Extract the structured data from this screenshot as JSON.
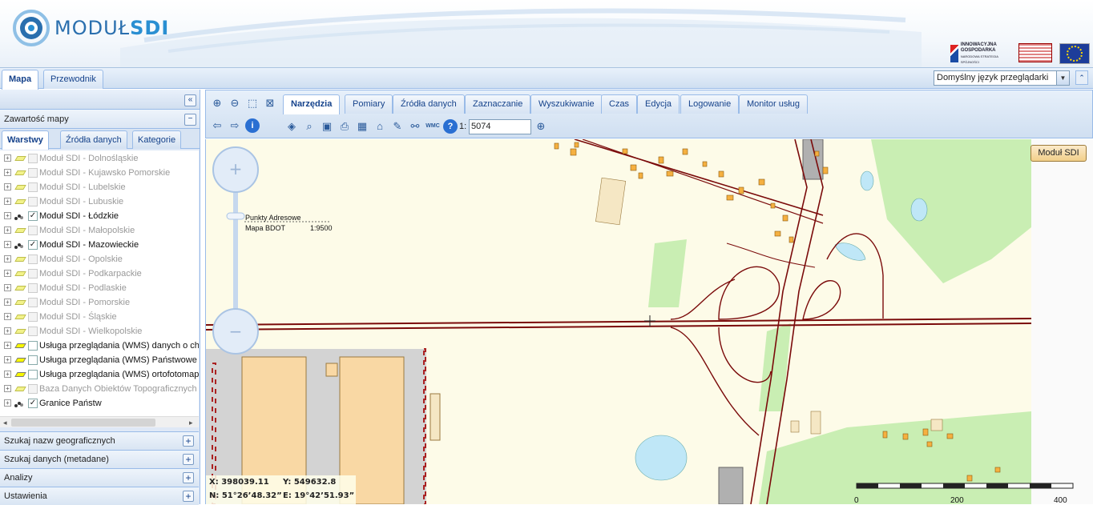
{
  "header": {
    "logo_text_a": "MODUŁ",
    "logo_text_b": "SDI",
    "eu_logo_1_title": "INNOWACYJNA GOSPODARKA",
    "eu_logo_1_sub": "NARODOWA STRATEGIA SPÓJNOŚCI"
  },
  "topbar": {
    "tabs": [
      "Mapa",
      "Przewodnik"
    ],
    "language_select": "Domyślny język przeglądarki"
  },
  "leftpanel": {
    "contents_title": "Zawartość mapy",
    "tabs": [
      "Warstwy",
      "Źródła danych",
      "Kategorie"
    ],
    "layers": [
      {
        "label": "Moduł SDI - Dolnośląskie",
        "icon": "polygon-icon",
        "checked": false,
        "enabled": false
      },
      {
        "label": "Moduł SDI - Kujawsko Pomorskie",
        "icon": "polygon-icon",
        "checked": false,
        "enabled": false
      },
      {
        "label": "Moduł SDI - Lubelskie",
        "icon": "polygon-icon",
        "checked": false,
        "enabled": false
      },
      {
        "label": "Moduł SDI - Lubuskie",
        "icon": "polygon-icon",
        "checked": false,
        "enabled": false
      },
      {
        "label": "Moduł SDI - Łódzkie",
        "icon": "points-icon",
        "checked": true,
        "enabled": true
      },
      {
        "label": "Moduł SDI - Małopolskie",
        "icon": "polygon-icon",
        "checked": false,
        "enabled": false
      },
      {
        "label": "Moduł SDI - Mazowieckie",
        "icon": "points-icon",
        "checked": true,
        "enabled": true
      },
      {
        "label": "Moduł SDI - Opolskie",
        "icon": "polygon-icon",
        "checked": false,
        "enabled": false
      },
      {
        "label": "Moduł SDI - Podkarpackie",
        "icon": "polygon-icon",
        "checked": false,
        "enabled": false
      },
      {
        "label": "Moduł SDI - Podlaskie",
        "icon": "polygon-icon",
        "checked": false,
        "enabled": false
      },
      {
        "label": "Moduł SDI - Pomorskie",
        "icon": "polygon-icon",
        "checked": false,
        "enabled": false
      },
      {
        "label": "Moduł SDI - Śląskie",
        "icon": "polygon-icon",
        "checked": false,
        "enabled": false
      },
      {
        "label": "Moduł SDI - Wielkopolskie",
        "icon": "polygon-icon",
        "checked": false,
        "enabled": false
      },
      {
        "label": "Usługa przeglądania (WMS) danych o ch",
        "icon": "polygon-icon-bold",
        "checked": false,
        "enabled": true
      },
      {
        "label": "Usługa przeglądania (WMS) Państwowe",
        "icon": "polygon-icon-bold",
        "checked": false,
        "enabled": true
      },
      {
        "label": "Usługa przeglądania (WMS) ortofotomap",
        "icon": "polygon-icon-bold",
        "checked": false,
        "enabled": true
      },
      {
        "label": "Baza Danych Obiektów Topograficznych",
        "icon": "polygon-icon",
        "checked": false,
        "enabled": false
      },
      {
        "label": "Granice Państw",
        "icon": "points-icon",
        "checked": true,
        "enabled": true
      }
    ],
    "accordion": [
      "Szukaj nazw geograficznych",
      "Szukaj danych (metadane)",
      "Analizy",
      "Ustawienia"
    ]
  },
  "toolbar": {
    "tabs": [
      "Narzędzia",
      "Pomiary",
      "Źródła danych",
      "Zaznaczanie",
      "Wyszukiwanie",
      "Czas",
      "Edycja",
      "Logowanie",
      "Monitor usług"
    ],
    "scale_prefix": "1:",
    "scale_value": "5074"
  },
  "map": {
    "modul_button": "Moduł SDI",
    "legend_line1": "Punkty Adresowe",
    "legend_line2": "Mapa BDOT",
    "legend_scale": "1:9500",
    "coords": {
      "x": "X: 398039.11",
      "y": "Y: 549632.8",
      "n": "N: 51°26’48.32”",
      "e": "E: 19°42’51.93”"
    },
    "scalebar_labels": [
      "0",
      "200",
      "400"
    ]
  },
  "colors": {
    "accent": "#15428b",
    "panel_bg": "#dfe8f6",
    "map_bg": "#fdfbe8",
    "road": "#7a0a0a",
    "building": "#f5b040",
    "green": "#c9eeb3",
    "water": "#bfe7f7"
  }
}
